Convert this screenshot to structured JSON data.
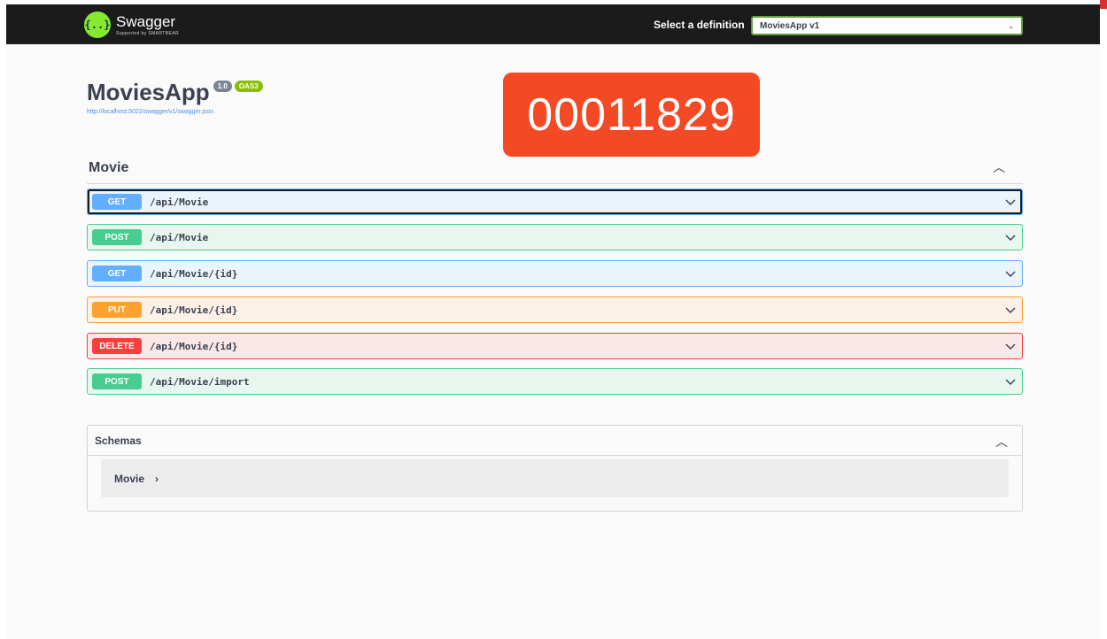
{
  "topbar": {
    "logo_icon": "{..}",
    "logo_text": "Swagger",
    "logo_subtext": "Supported by SMARTBEAR",
    "select_label": "Select a definition",
    "selected_definition": "MoviesApp v1",
    "background": "#1b1b1b"
  },
  "info": {
    "title": "MoviesApp",
    "version_badge": "1.0",
    "oas_badge": "OAS3",
    "spec_url": "http://localhost:5022/swagger/v1/swagger.json"
  },
  "overlay": {
    "stamp_text": "00011829",
    "stamp_color": "#f34924"
  },
  "tag": {
    "name": "Movie",
    "operations": [
      {
        "method": "GET",
        "path": "/api/Movie"
      },
      {
        "method": "POST",
        "path": "/api/Movie"
      },
      {
        "method": "GET",
        "path": "/api/Movie/{id}"
      },
      {
        "method": "PUT",
        "path": "/api/Movie/{id}"
      },
      {
        "method": "DELETE",
        "path": "/api/Movie/{id}"
      },
      {
        "method": "POST",
        "path": "/api/Movie/import"
      }
    ]
  },
  "schemas": {
    "title": "Schemas",
    "models": [
      "Movie"
    ]
  },
  "colors": {
    "get": "#61affe",
    "post": "#49cc90",
    "put": "#fca130",
    "delete": "#f93e3e",
    "logo": "#85ea2d"
  }
}
